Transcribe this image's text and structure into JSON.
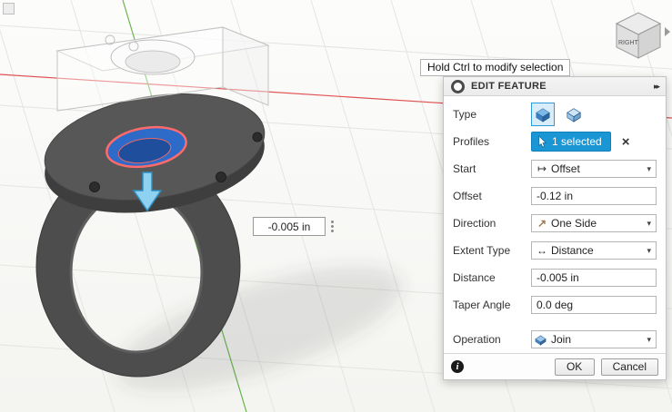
{
  "canvas": {
    "tooltip": "Hold Ctrl to modify selection",
    "floating_input": {
      "value": "-0.005 in"
    },
    "viewcube": {
      "face": "RIGHT"
    }
  },
  "dialog": {
    "title": "EDIT FEATURE",
    "rows": {
      "type": {
        "label": "Type"
      },
      "profiles": {
        "label": "Profiles",
        "button": "1 selected"
      },
      "start": {
        "label": "Start",
        "value": "Offset"
      },
      "offset": {
        "label": "Offset",
        "value": "-0.12 in"
      },
      "direction": {
        "label": "Direction",
        "value": "One Side"
      },
      "extent_type": {
        "label": "Extent Type",
        "value": "Distance"
      },
      "distance": {
        "label": "Distance",
        "value": "-0.005 in"
      },
      "taper_angle": {
        "label": "Taper Angle",
        "value": "0.0 deg"
      },
      "operation": {
        "label": "Operation",
        "value": "Join"
      }
    },
    "buttons": {
      "ok": "OK",
      "cancel": "Cancel"
    }
  },
  "icons": {
    "close": "×",
    "expand": "▸▸",
    "dropdown": "▾",
    "info": "i",
    "start_offset": "↦",
    "extent_distance": "↔",
    "direction_arrow": "↗"
  },
  "colors": {
    "accent_blue": "#1a96d5",
    "selection_red": "#ff6a6a",
    "profile_blue": "#2e6bc8",
    "arrow_blue": "#8ed1f0",
    "model_gray": "#4f4f4f",
    "axis_red": "#e05252",
    "axis_green": "#6ab54e"
  }
}
